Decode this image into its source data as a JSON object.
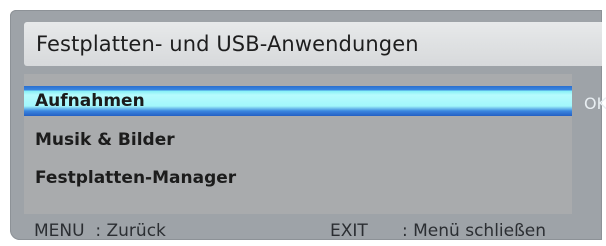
{
  "window": {
    "title": "Festplatten- und USB-Anwendungen"
  },
  "menu": {
    "items": [
      {
        "label": "Aufnahmen",
        "selected": true
      },
      {
        "label": "Musik & Bilder",
        "selected": false
      },
      {
        "label": "Festplatten-Manager",
        "selected": false
      }
    ],
    "ok_hint": "OK"
  },
  "footer": {
    "back": "MENU  : Zurück",
    "exit_key": "EXIT",
    "exit_desc": ": Menü schließen"
  },
  "colors": {
    "panel": "#9ea3a8",
    "selection_highlight": "#a2f7fb",
    "selection_border": "#2a6fcf"
  }
}
